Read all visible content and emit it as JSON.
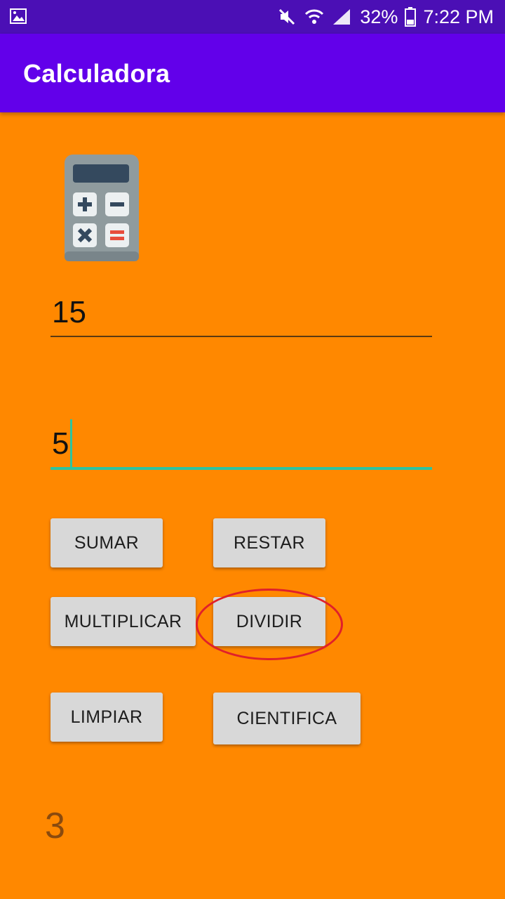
{
  "status_bar": {
    "battery": "32%",
    "time": "7:22 PM",
    "icons": [
      "image-icon",
      "mute-icon",
      "wifi-icon",
      "signal-icon",
      "battery-icon"
    ]
  },
  "app_bar": {
    "title": "Calculadora"
  },
  "main": {
    "logo": "calculator-icon",
    "field1_value": "15",
    "field2_value": "5",
    "buttons": {
      "sumar": "SUMAR",
      "restar": "RESTAR",
      "multiplicar": "MULTIPLICAR",
      "dividir": "DIVIDIR",
      "limpiar": "LIMPIAR",
      "cientifica": "CIENTIFICA"
    },
    "result": "3"
  },
  "colors": {
    "background": "#ff8800",
    "app_bar": "#6200ea",
    "status_bar": "#4b0fb5",
    "accent": "#2ec4a0",
    "highlight_circle": "#e0202a"
  }
}
